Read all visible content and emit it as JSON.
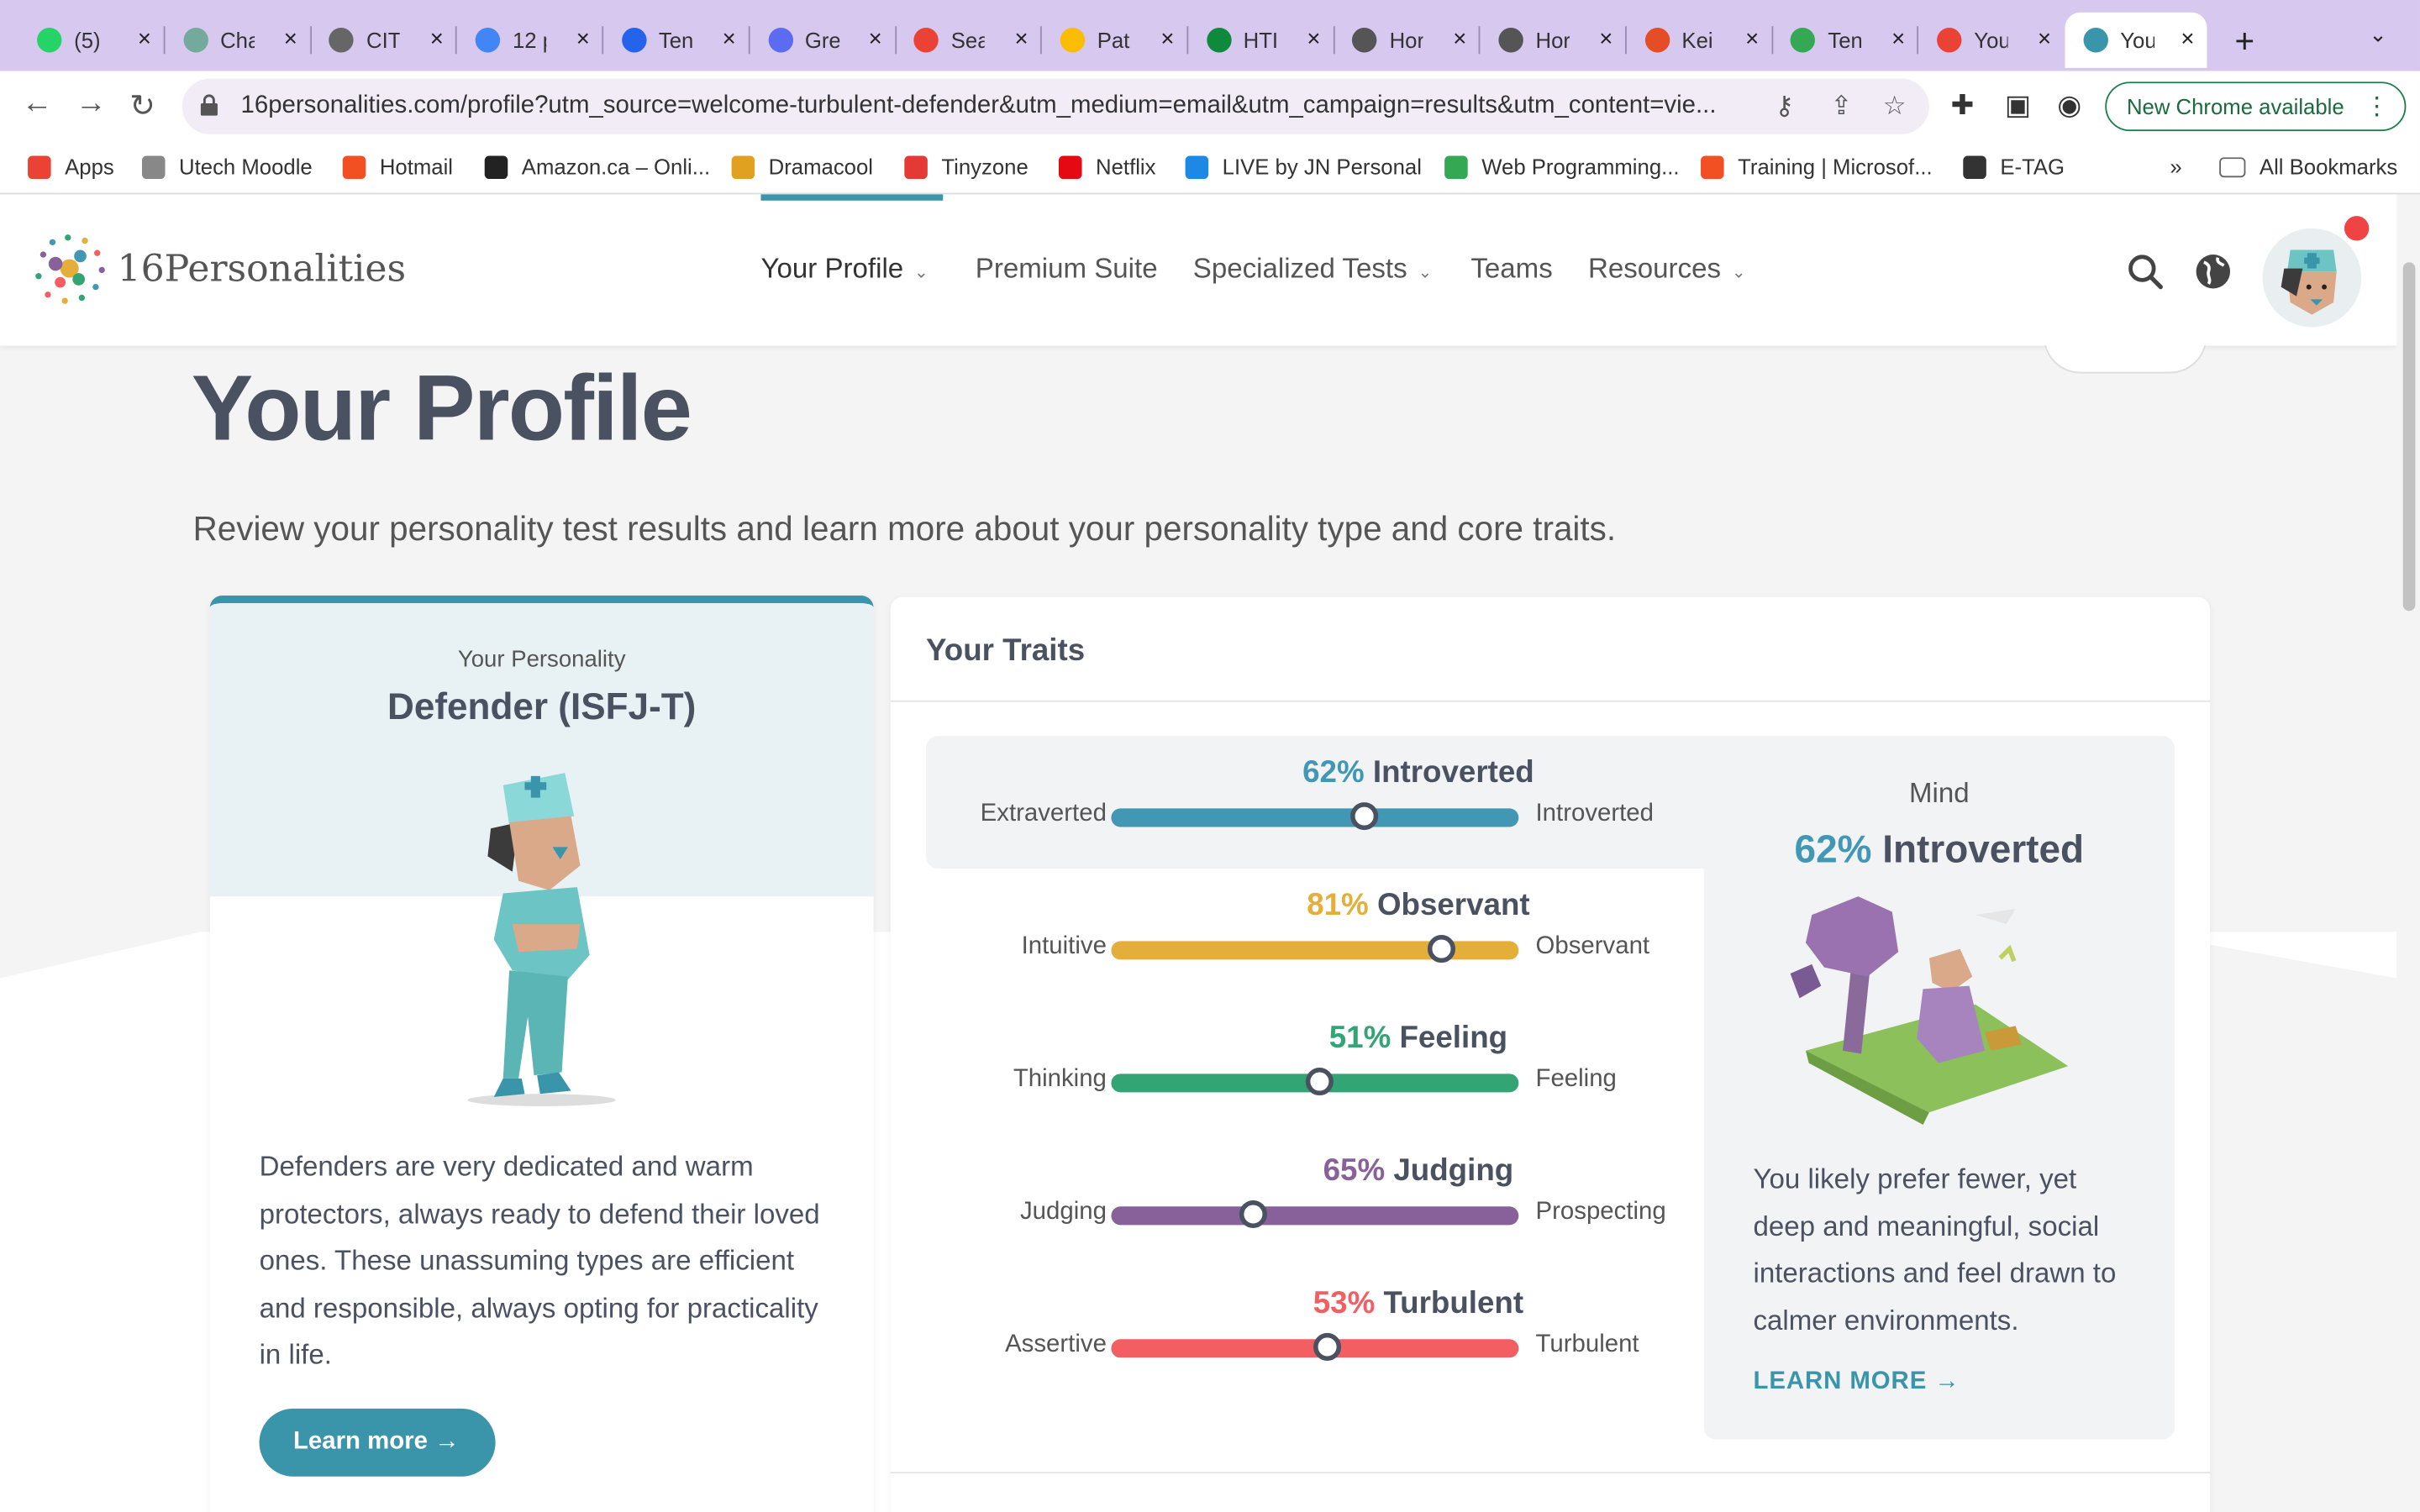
{
  "tabs": [
    {
      "label": "(5)",
      "color": "#25d366"
    },
    {
      "label": "Cha",
      "color": "#74aa9c"
    },
    {
      "label": "CIT",
      "color": "#666666"
    },
    {
      "label": "12 p",
      "color": "#4285f4"
    },
    {
      "label": "Ten",
      "color": "#2563eb"
    },
    {
      "label": "Gre",
      "color": "#5b6cf0"
    },
    {
      "label": "Sea",
      "color": "#ea4335"
    },
    {
      "label": "Pat",
      "color": "#fbbc04"
    },
    {
      "label": "HTI",
      "color": "#0f8a3c"
    },
    {
      "label": "Hor",
      "color": "#555555"
    },
    {
      "label": "Hor",
      "color": "#555555"
    },
    {
      "label": "Kei",
      "color": "#e44d26"
    },
    {
      "label": "Ten",
      "color": "#34a853"
    },
    {
      "label": "You",
      "color": "#ea4335"
    },
    {
      "label": "You",
      "color": "#3a94aa"
    }
  ],
  "new_tab": "+",
  "tab_search": "⌄",
  "url": "16personalities.com/profile?utm_source=welcome-turbulent-defender&utm_medium=email&utm_campaign=results&utm_content=vie...",
  "chrome_update": "New Chrome available",
  "bookmarks": [
    {
      "label": "Apps",
      "color": "#ea4335"
    },
    {
      "label": "Utech Moodle",
      "color": "#888888"
    },
    {
      "label": "Hotmail",
      "color": "#f25022"
    },
    {
      "label": "Amazon.ca – Onli...",
      "color": "#222222"
    },
    {
      "label": "Dramacool",
      "color": "#e0a020"
    },
    {
      "label": "Tinyzone",
      "color": "#e53935"
    },
    {
      "label": "Netflix",
      "color": "#e50914"
    },
    {
      "label": "LIVE by JN Personal",
      "color": "#1e88e5"
    },
    {
      "label": "Web Programming...",
      "color": "#34a853"
    },
    {
      "label": "Training | Microsof...",
      "color": "#f25022"
    },
    {
      "label": "E-TAG",
      "color": "#333333"
    }
  ],
  "bookmarks_more": "»",
  "all_bookmarks": "All Bookmarks",
  "site": {
    "brand": "16Personalities",
    "menu": [
      {
        "label": "Your Profile",
        "chevron": true
      },
      {
        "label": "Premium Suite",
        "chevron": false
      },
      {
        "label": "Specialized Tests",
        "chevron": true
      },
      {
        "label": "Teams",
        "chevron": false
      },
      {
        "label": "Resources",
        "chevron": true
      }
    ]
  },
  "page": {
    "title": "Your Profile",
    "subtitle": "Review your personality test results and learn more about your personality type and core traits."
  },
  "personality": {
    "caption": "Your Personality",
    "type": "Defender (ISFJ-T)",
    "description": "Defenders are very dedicated and warm protectors, always ready to defend their loved ones. These unassuming types are efficient and responsible, always opting for practicality in life.",
    "button": "Learn more →"
  },
  "traits": {
    "title": "Your Traits",
    "rows": [
      {
        "pct": "62%",
        "trait": "Introverted",
        "left": "Extraverted",
        "right": "Introverted",
        "value": 0.62,
        "color": "#4298b4"
      },
      {
        "pct": "81%",
        "trait": "Observant",
        "left": "Intuitive",
        "right": "Observant",
        "value": 0.81,
        "color": "#e4ae3a"
      },
      {
        "pct": "51%",
        "trait": "Feeling",
        "left": "Thinking",
        "right": "Feeling",
        "value": 0.51,
        "color": "#33a474"
      },
      {
        "pct": "65%",
        "trait": "Judging",
        "left": "Judging",
        "right": "Prospecting",
        "value": 0.35,
        "color": "#88619a"
      },
      {
        "pct": "53%",
        "trait": "Turbulent",
        "left": "Assertive",
        "right": "Turbulent",
        "value": 0.53,
        "color": "#f25e62"
      }
    ],
    "side": {
      "category": "Mind",
      "pct": "62%",
      "trait": "Introverted",
      "description": "You likely prefer fewer, yet deep and meaningful, social interactions and feel drawn to calmer environments.",
      "link": "LEARN MORE →"
    }
  }
}
